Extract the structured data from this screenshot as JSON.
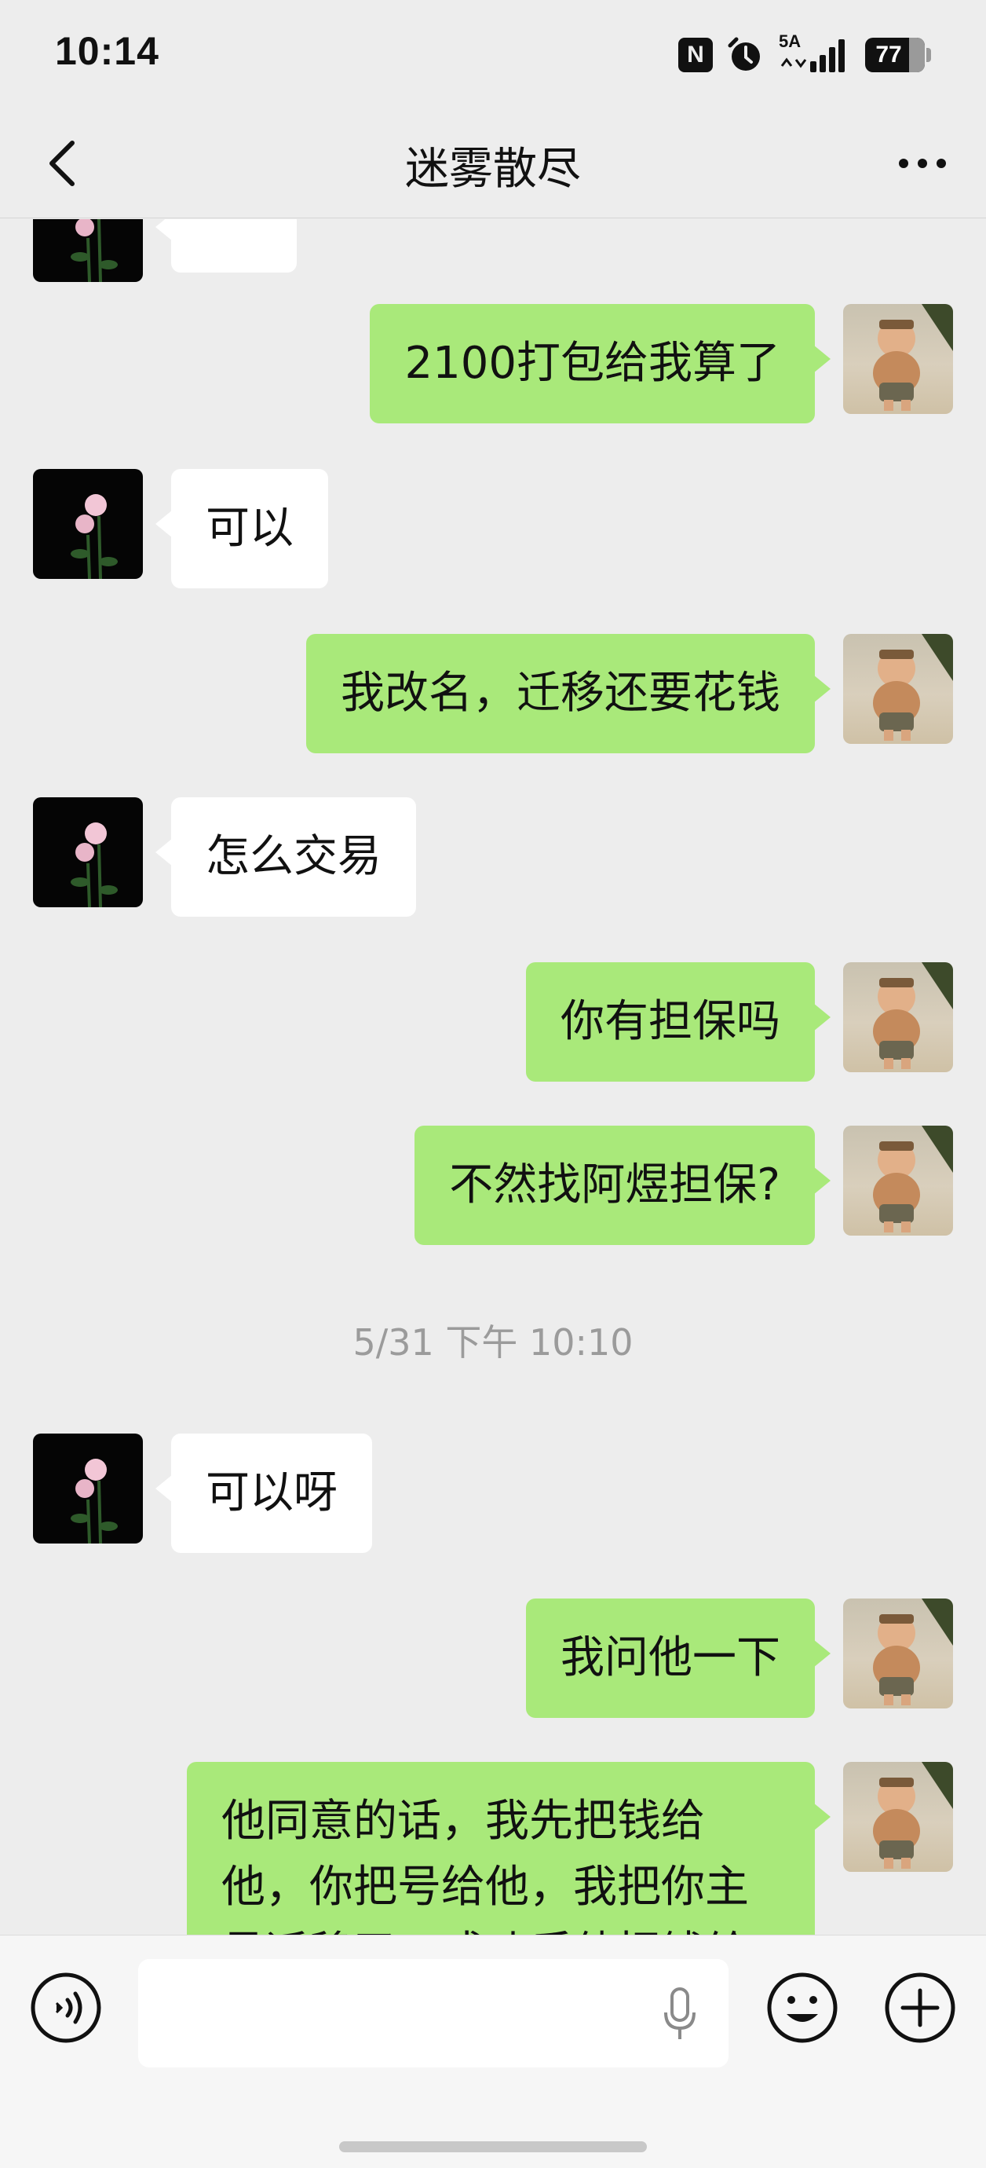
{
  "status_bar": {
    "time": "10:14",
    "nfc_label": "N",
    "signal_label": "5A",
    "battery_level": "77"
  },
  "header": {
    "title": "迷雾散尽"
  },
  "messages": [
    {
      "side": "out",
      "text": "2100打包给我算了"
    },
    {
      "side": "in",
      "text": "可以"
    },
    {
      "side": "out",
      "text": "我改名，迁移还要花钱"
    },
    {
      "side": "in",
      "text": "怎么交易"
    },
    {
      "side": "out",
      "text": "你有担保吗"
    },
    {
      "side": "out",
      "text": "不然找阿煜担保?"
    },
    {
      "side": "in",
      "text": "可以呀"
    },
    {
      "side": "out",
      "text": "我问他一下"
    },
    {
      "side": "out",
      "text": "他同意的话，我先把钱给他，你把号给他，我把你主号迁移了，成功后他把钱给"
    }
  ],
  "timestamp": "5/31 下午 10:10",
  "icons": {
    "back": "chevron-left-icon",
    "more": "more-icon",
    "voice": "voice-icon",
    "mic": "mic-icon",
    "emoji": "emoji-icon",
    "plus": "plus-icon"
  },
  "colors": {
    "background": "#ededed",
    "outgoing_bubble": "#a9e97a",
    "incoming_bubble": "#ffffff",
    "timestamp_text": "#9b9b9b"
  }
}
